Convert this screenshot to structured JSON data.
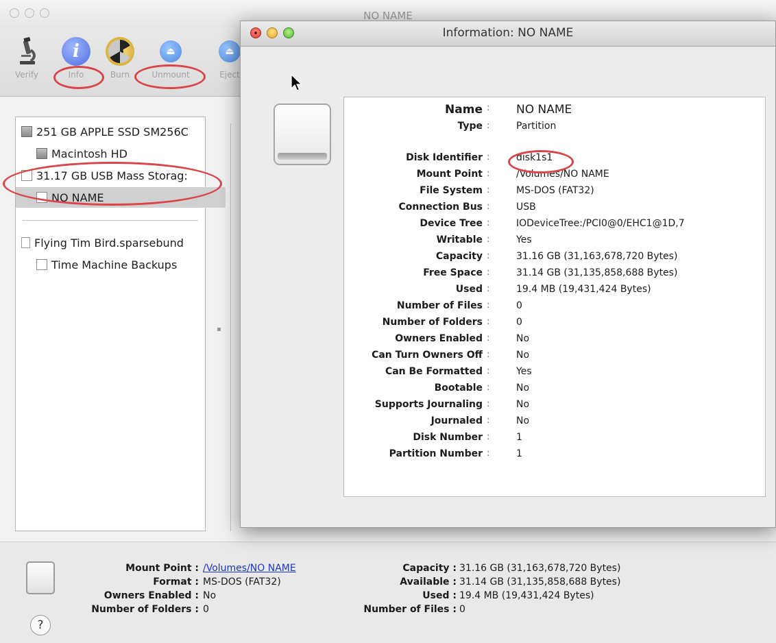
{
  "disk_utility": {
    "title": "NO NAME",
    "toolbar": {
      "verify": "Verify",
      "info": "Info",
      "burn": "Burn",
      "unmount": "Unmount",
      "eject": "Eject"
    },
    "sidebar": {
      "items": [
        {
          "label": "251 GB APPLE SSD SM256C",
          "icon": "internal-disk-icon"
        },
        {
          "label": "Macintosh HD",
          "icon": "volume-icon"
        },
        {
          "label": "31.17 GB USB Mass Storag:",
          "icon": "external-disk-icon"
        },
        {
          "label": "NO NAME",
          "icon": "volume-icon",
          "selected": true
        },
        {
          "label": "Flying Tim Bird.sparsebund",
          "icon": "disk-image-icon"
        },
        {
          "label": "Time Machine Backups",
          "icon": "volume-icon"
        }
      ]
    },
    "info_bar": {
      "mount_point_label": "Mount Point :",
      "mount_point_value": "/Volumes/NO NAME",
      "format_label": "Format :",
      "format_value": "MS-DOS (FAT32)",
      "owners_enabled_label": "Owners Enabled :",
      "owners_enabled_value": "No",
      "folders_label": "Number of Folders :",
      "folders_value": "0",
      "capacity_label": "Capacity :",
      "capacity_value": "31.16 GB (31,163,678,720 Bytes)",
      "available_label": "Available :",
      "available_value": "31.14 GB (31,135,858,688 Bytes)",
      "used_label": "Used :",
      "used_value": "19.4 MB (19,431,424 Bytes)",
      "files_label": "Number of Files :",
      "files_value": "0",
      "help": "?"
    }
  },
  "info_window": {
    "title": "Information: NO NAME",
    "rows": [
      {
        "label": "Name",
        "value": "NO NAME"
      },
      {
        "label": "Type",
        "value": "Partition"
      },
      {
        "label": "Disk Identifier",
        "value": "disk1s1"
      },
      {
        "label": "Mount Point",
        "value": "/Volumes/NO NAME"
      },
      {
        "label": "File System",
        "value": "MS-DOS (FAT32)"
      },
      {
        "label": "Connection Bus",
        "value": "USB"
      },
      {
        "label": "Device Tree",
        "value": "IODeviceTree:/PCI0@0/EHC1@1D,7"
      },
      {
        "label": "Writable",
        "value": "Yes"
      },
      {
        "label": "Capacity",
        "value": "31.16 GB (31,163,678,720 Bytes)"
      },
      {
        "label": "Free Space",
        "value": "31.14 GB (31,135,858,688 Bytes)"
      },
      {
        "label": "Used",
        "value": "19.4 MB (19,431,424 Bytes)"
      },
      {
        "label": "Number of Files",
        "value": "0"
      },
      {
        "label": "Number of Folders",
        "value": "0"
      },
      {
        "label": "Owners Enabled",
        "value": "No"
      },
      {
        "label": "Can Turn Owners Off",
        "value": "No"
      },
      {
        "label": "Can Be Formatted",
        "value": "Yes"
      },
      {
        "label": "Bootable",
        "value": "No"
      },
      {
        "label": "Supports Journaling",
        "value": "No"
      },
      {
        "label": "Journaled",
        "value": "No"
      },
      {
        "label": "Disk Number",
        "value": "1"
      },
      {
        "label": "Partition Number",
        "value": "1"
      }
    ]
  },
  "colors": {
    "annotation_red": "#d9454a",
    "info_icon_blue": "#5b7de6",
    "link_blue": "#1a36c9"
  }
}
